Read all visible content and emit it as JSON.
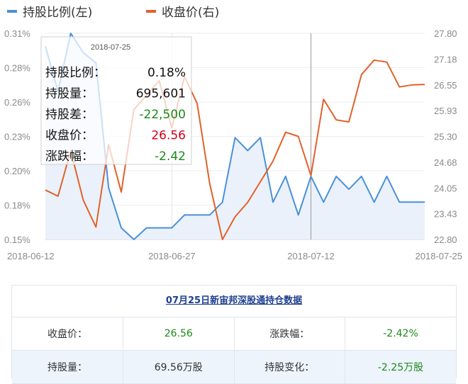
{
  "legend": [
    {
      "label": "持股比例(左)",
      "color": "#4a90d9"
    },
    {
      "label": "收盘价(右)",
      "color": "#e0622a"
    }
  ],
  "chart_data": {
    "type": "line",
    "x": [
      "2018-06-12",
      "2018-06-13",
      "2018-06-14",
      "2018-06-15",
      "2018-06-19",
      "2018-06-20",
      "2018-06-21",
      "2018-06-22",
      "2018-06-25",
      "2018-06-26",
      "2018-06-27",
      "2018-06-28",
      "2018-06-29",
      "2018-07-02",
      "2018-07-03",
      "2018-07-04",
      "2018-07-05",
      "2018-07-06",
      "2018-07-09",
      "2018-07-10",
      "2018-07-11",
      "2018-07-12",
      "2018-07-13",
      "2018-07-16",
      "2018-07-17",
      "2018-07-18",
      "2018-07-19",
      "2018-07-20",
      "2018-07-23",
      "2018-07-24",
      "2018-07-25"
    ],
    "x_ticks": [
      "2018-06-12",
      "2018-06-27",
      "2018-07-12",
      "2018-07-25"
    ],
    "y_left": {
      "min": 0.15,
      "max": 0.31,
      "ticks": [
        "0.15%",
        "0.18%",
        "0.20%",
        "0.23%",
        "0.26%",
        "0.28%",
        "0.31%"
      ],
      "unit": "%"
    },
    "y_right": {
      "min": 22.8,
      "max": 27.8,
      "ticks": [
        "22.80",
        "23.43",
        "24.05",
        "24.68",
        "25.30",
        "25.93",
        "26.55",
        "27.18",
        "27.80"
      ]
    },
    "series": [
      {
        "name": "持股比例(左)",
        "axis": "left",
        "color": "#4a90d9",
        "area": true,
        "values": [
          0.3,
          0.265,
          0.31,
          0.295,
          0.287,
          0.19,
          0.159,
          0.15,
          0.159,
          0.159,
          0.159,
          0.169,
          0.169,
          0.169,
          0.179,
          0.229,
          0.219,
          0.229,
          0.179,
          0.199,
          0.169,
          0.199,
          0.179,
          0.199,
          0.189,
          0.199,
          0.179,
          0.199,
          0.179,
          0.179,
          0.179
        ]
      },
      {
        "name": "收盘价(右)",
        "axis": "right",
        "color": "#e0622a",
        "area": false,
        "values": [
          24.0,
          23.85,
          24.95,
          23.75,
          23.1,
          25.1,
          23.95,
          25.95,
          26.3,
          26.65,
          25.5,
          26.75,
          26.1,
          24.15,
          22.8,
          23.35,
          23.7,
          24.2,
          24.7,
          25.4,
          25.3,
          24.35,
          26.2,
          25.7,
          25.65,
          26.8,
          27.15,
          27.1,
          26.5,
          26.55,
          26.56
        ]
      }
    ],
    "highlight_x": "2018-07-12"
  },
  "tooltip": {
    "date": "2018-07-25",
    "rows": [
      {
        "label": "持股比例：",
        "value": "0.18%",
        "color": "#111111"
      },
      {
        "label": "持股量：",
        "value": "695,601",
        "color": "#111111"
      },
      {
        "label": "持股差：",
        "value": "-22,500",
        "color": "#1a8a1a"
      },
      {
        "label": "收盘价：",
        "value": "26.56",
        "color": "#d0021b"
      },
      {
        "label": "涨跌幅：",
        "value": "-2.42",
        "color": "#1a8a1a"
      }
    ]
  },
  "summary": {
    "title": "07月25日新宙邦深股通持仓数据",
    "rows": [
      [
        {
          "text": "收盘价：",
          "green": false
        },
        {
          "text": "26.56",
          "green": true
        },
        {
          "text": "涨跌幅：",
          "green": false
        },
        {
          "text": "-2.42%",
          "green": true
        }
      ],
      [
        {
          "text": "持股量：",
          "green": false
        },
        {
          "text": "69.56万股",
          "green": false
        },
        {
          "text": "持股变化：",
          "green": false
        },
        {
          "text": "-2.25万股",
          "green": true
        }
      ]
    ]
  }
}
